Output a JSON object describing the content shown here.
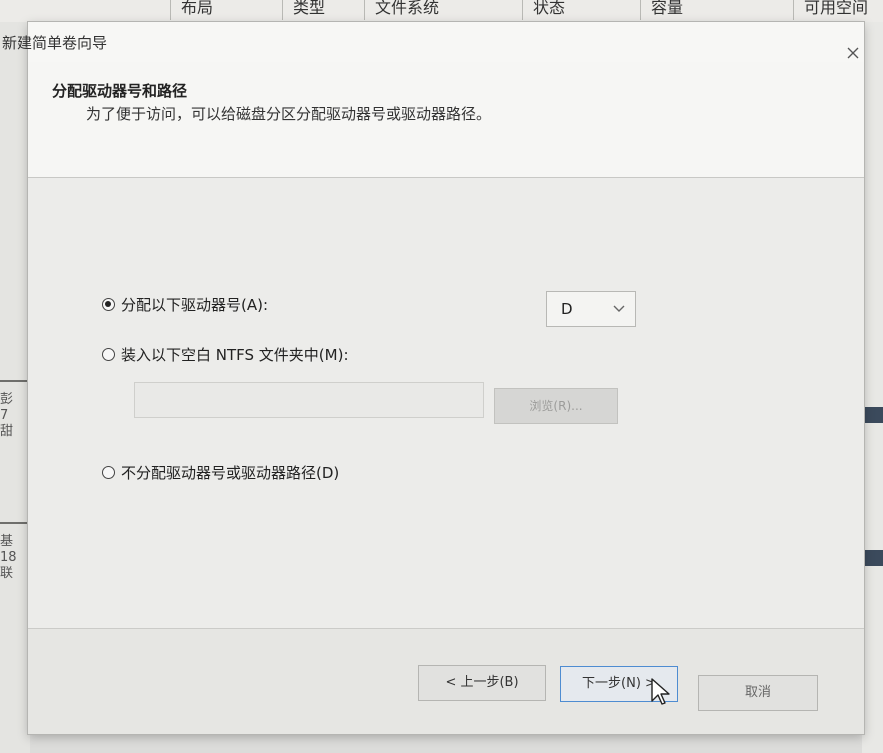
{
  "background": {
    "columns": [
      {
        "label": "布局"
      },
      {
        "label": "类型"
      },
      {
        "label": "文件系统"
      },
      {
        "label": "状态"
      },
      {
        "label": "容量"
      },
      {
        "label": "可用空间"
      }
    ],
    "left_fragments": [
      "彭",
      "7",
      "甜",
      "基",
      "18",
      "联"
    ]
  },
  "wizard": {
    "window_title": "新建简单卷向导",
    "close_icon": "close-icon",
    "step_title": "分配驱动器号和路径",
    "step_description": "为了便于访问，可以给磁盘分区分配驱动器号或驱动器路径。",
    "options": {
      "assign_letter": {
        "label": "分配以下驱动器号(A):",
        "checked": true
      },
      "mount_folder": {
        "label": "装入以下空白 NTFS 文件夹中(M):",
        "checked": false
      },
      "no_letter": {
        "label": "不分配驱动器号或驱动器路径(D)",
        "checked": false
      }
    },
    "drive_letter": {
      "value": "D"
    },
    "folder_path": {
      "value": "",
      "disabled": true
    },
    "browse_label": "浏览(R)...",
    "buttons": {
      "back": "< 上一步(B)",
      "next": "下一步(N) >",
      "cancel": "取消"
    }
  },
  "colors": {
    "focus_border": "#4e8cd1",
    "window_bg": "#f1f1ef"
  }
}
